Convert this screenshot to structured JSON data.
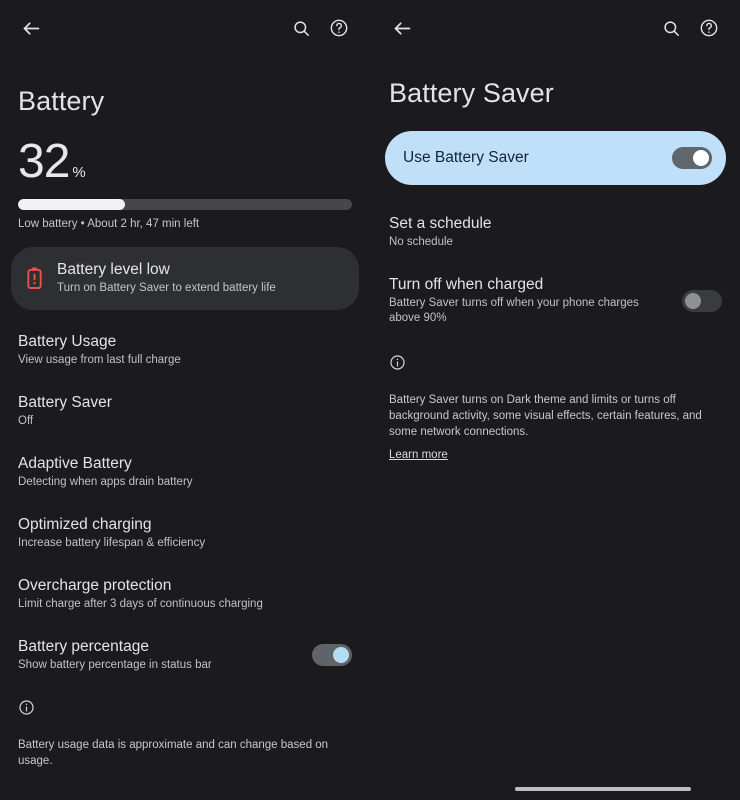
{
  "colors": {
    "background": "#1b1b1d",
    "card": "#2e2f32",
    "hero_card": "#bfe0f8",
    "accent_blue": "#b6dcf4",
    "warning_red": "#e8514a",
    "bar_fill": "#f2f1f4",
    "bar_track": "#45474a"
  },
  "left_pane": {
    "appbar": {
      "back_icon": "back-arrow-icon",
      "search_icon": "search-icon",
      "help_icon": "help-circle-icon"
    },
    "title": "Battery",
    "battery": {
      "percent_value": "32",
      "percent_sign": "%",
      "percent_number": 32,
      "status_caption": "Low battery • About 2 hr, 47 min left"
    },
    "warning_card": {
      "icon": "battery-alert-icon",
      "title": "Battery level low",
      "subtitle": "Turn on Battery Saver to extend battery life"
    },
    "items": [
      {
        "name": "battery-usage",
        "title": "Battery Usage",
        "subtitle": "View usage from last full charge",
        "has_switch": false
      },
      {
        "name": "battery-saver",
        "title": "Battery Saver",
        "subtitle": "Off",
        "has_switch": false
      },
      {
        "name": "adaptive-battery",
        "title": "Adaptive Battery",
        "subtitle": "Detecting when apps drain battery",
        "has_switch": false
      },
      {
        "name": "optimized-charging",
        "title": "Optimized charging",
        "subtitle": "Increase battery lifespan & efficiency",
        "has_switch": false
      },
      {
        "name": "overcharge-protection",
        "title": "Overcharge protection",
        "subtitle": "Limit charge after 3 days of continuous charging",
        "has_switch": false
      },
      {
        "name": "battery-percentage",
        "title": "Battery percentage",
        "subtitle": "Show battery percentage in status bar",
        "has_switch": true,
        "switch_state": "on"
      }
    ],
    "footer": {
      "icon": "info-circle-icon",
      "text": "Battery usage data is approximate and can change based on usage."
    }
  },
  "right_pane": {
    "appbar": {
      "back_icon": "back-arrow-icon",
      "search_icon": "search-icon",
      "help_icon": "help-circle-icon"
    },
    "title": "Battery Saver",
    "hero": {
      "label": "Use Battery Saver",
      "switch_state": "on"
    },
    "items": [
      {
        "name": "set-a-schedule",
        "title": "Set a schedule",
        "subtitle": "No schedule",
        "has_switch": false
      },
      {
        "name": "turn-off-when-charged",
        "title": "Turn off when charged",
        "subtitle": "Battery Saver turns off when your phone charges above 90%",
        "has_switch": true,
        "switch_state": "off"
      }
    ],
    "footer": {
      "icon": "info-circle-icon",
      "text": "Battery Saver turns on Dark theme and limits or turns off background activity, some visual effects, certain features, and some network connections.",
      "learn_more": "Learn more"
    }
  },
  "system": {
    "gesture_bar": "home-gesture-bar"
  }
}
